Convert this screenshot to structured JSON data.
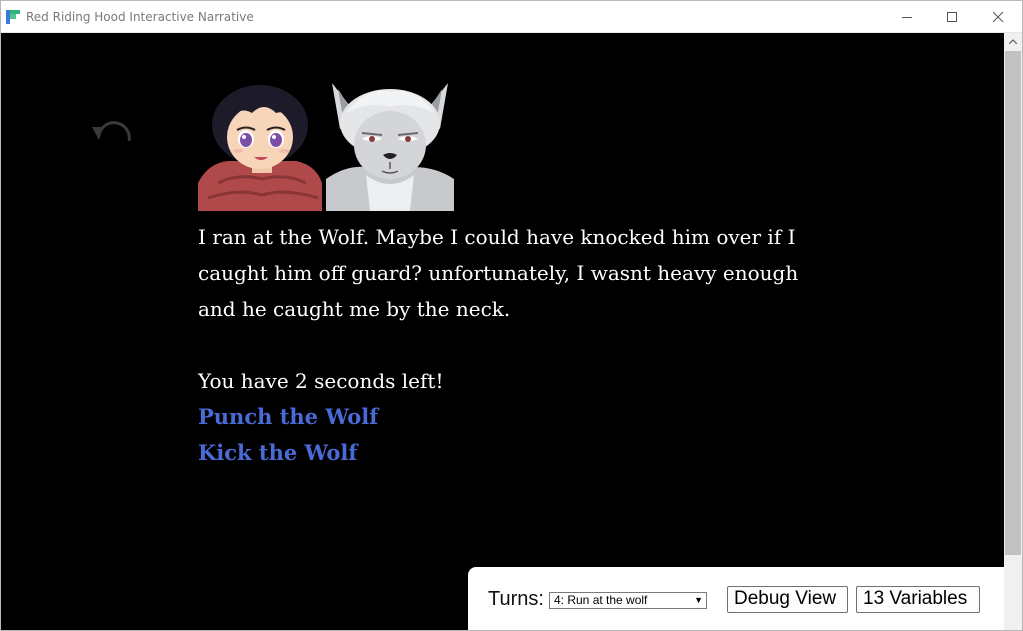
{
  "window": {
    "title": "Red Riding Hood Interactive Narrative",
    "logo_icon": "app-logo-icon",
    "controls": [
      "minimize-icon",
      "maximize-icon",
      "close-icon"
    ],
    "title_color": "#7a7a7a"
  },
  "story": {
    "undo_icon": "undo-icon",
    "portraits": [
      "Red Riding Hood portrait",
      "Wolf portrait"
    ],
    "paragraph": "I ran at the Wolf. Maybe I could have knocked him over if I caught him off guard? unfortunately, I wasnt heavy enough and he caught me by the neck.",
    "timer": "You have 2 seconds left!",
    "choices": [
      {
        "label": "Punch the Wolf"
      },
      {
        "label": "Kick the Wolf"
      }
    ],
    "text_color": "#ffffff",
    "link_color": "#4a6ad6",
    "background": "#000000"
  },
  "debug": {
    "turns_label": "Turns:",
    "turns_selected": "4: Run at the wolf",
    "debug_view_label": "Debug View",
    "variables_label": "13 Variables"
  }
}
